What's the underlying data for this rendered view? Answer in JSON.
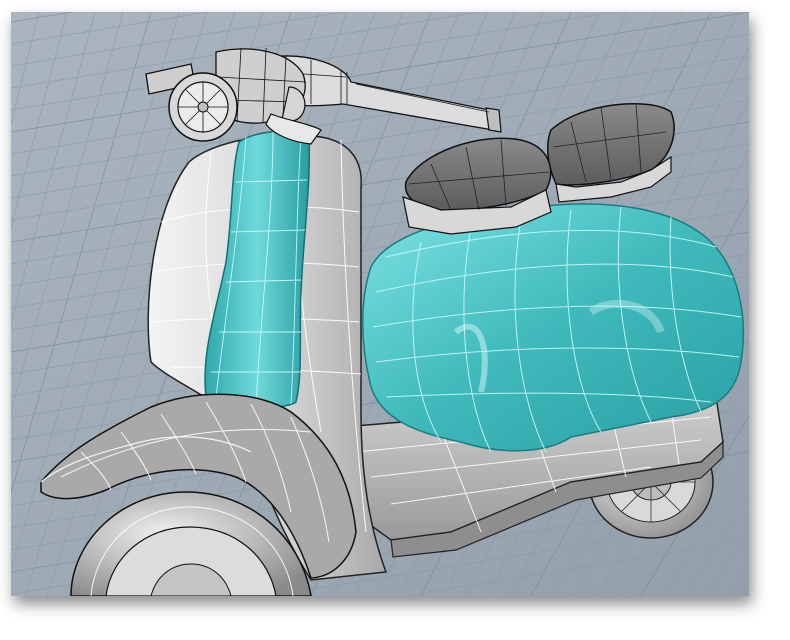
{
  "viewport": {
    "background_color": "#9eaab6",
    "grid_color": "#8d9aa7",
    "grid_major_color": "#7f8c99",
    "subject": "scooter-model",
    "selected_color": "#4fc8c8",
    "surface_color": "#d8d8d8",
    "isocurve_color": "#ffffff",
    "edge_color": "#1a1a1a"
  }
}
